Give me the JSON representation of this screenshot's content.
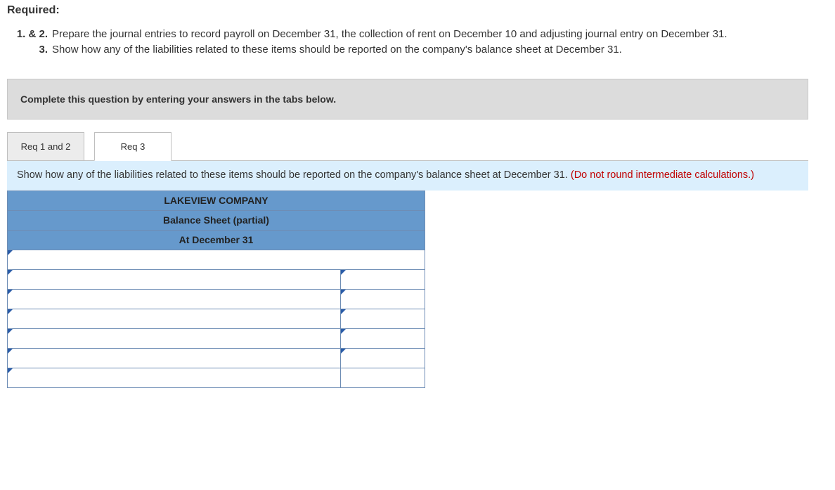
{
  "heading": "Required:",
  "requirements": [
    {
      "num": "1. & 2.",
      "text": "Prepare the journal entries to record payroll on December 31, the collection of rent on December 10 and adjusting journal entry on December 31."
    },
    {
      "num": "3.",
      "text": "Show how any of the liabilities related to these items should be reported on the company's balance sheet at December 31."
    }
  ],
  "instruction": "Complete this question by entering your answers in the tabs below.",
  "tabs": [
    {
      "label": "Req 1 and 2",
      "active": false
    },
    {
      "label": "Req 3",
      "active": true
    }
  ],
  "panel": {
    "text": "Show how any of the liabilities related to these items should be reported on the company's balance sheet at December 31.",
    "note": "(Do not round intermediate calculations.)"
  },
  "sheet": {
    "title": "LAKEVIEW COMPANY",
    "subtitle": "Balance Sheet (partial)",
    "date": "At December 31",
    "rows": [
      {
        "a": "",
        "b": null
      },
      {
        "a": "",
        "b": ""
      },
      {
        "a": "",
        "b": ""
      },
      {
        "a": "",
        "b": ""
      },
      {
        "a": "",
        "b": ""
      },
      {
        "a": "",
        "b": ""
      },
      {
        "a": "",
        "b_plain": ""
      }
    ]
  }
}
